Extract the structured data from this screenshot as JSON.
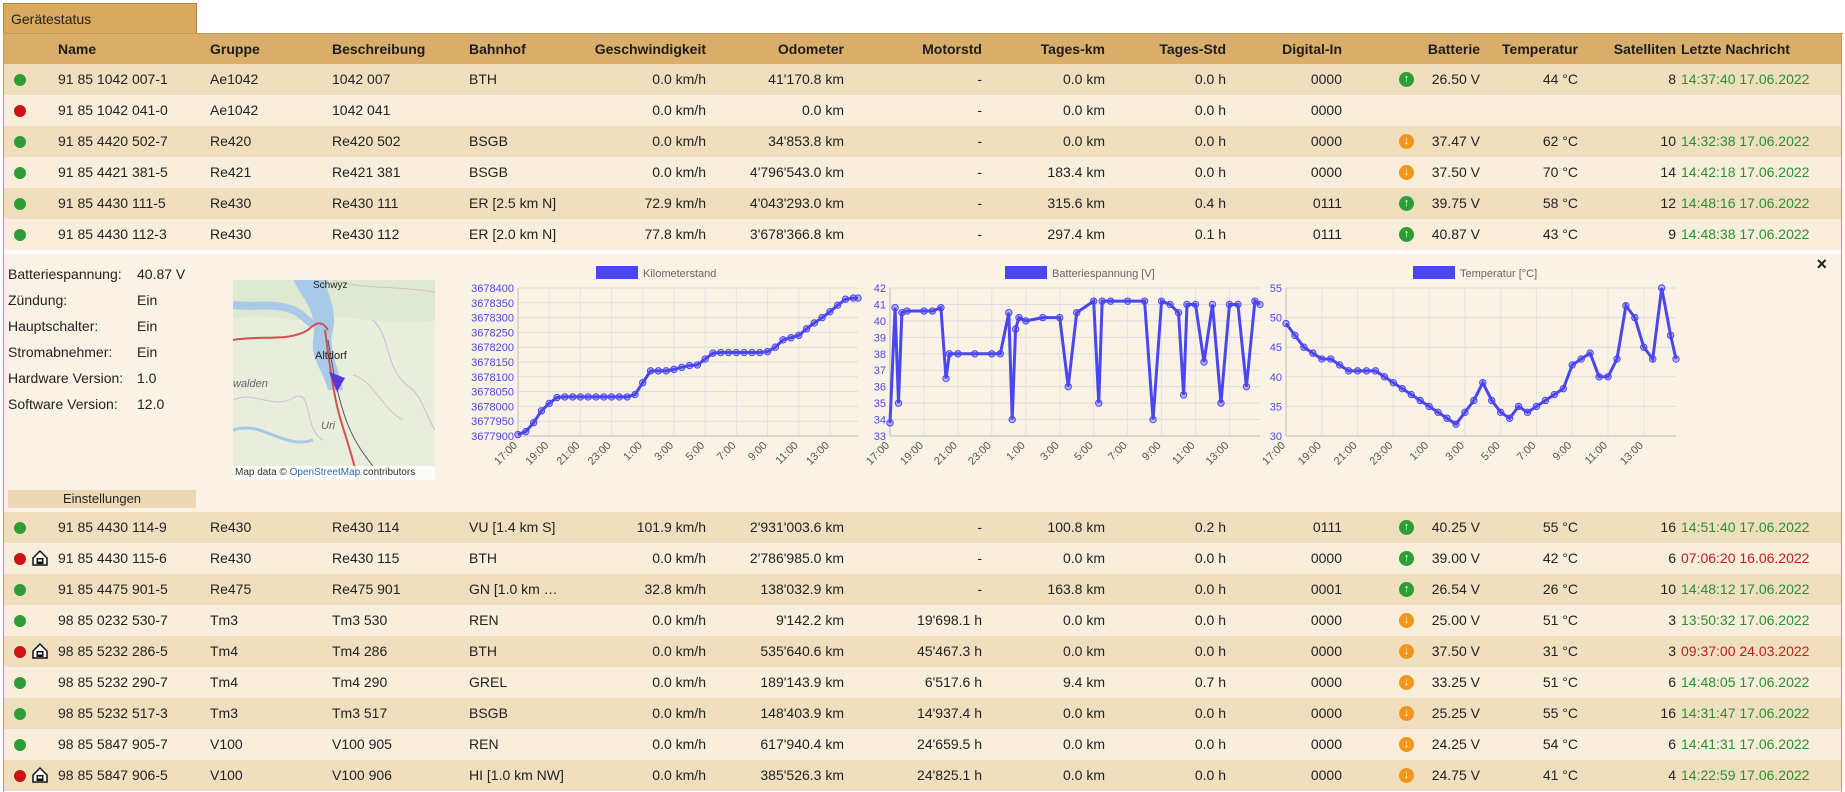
{
  "tab_title": "Gerätestatus",
  "columns": [
    "Name",
    "Gruppe",
    "Beschreibung",
    "Bahnhof",
    "Geschwindigkeit",
    "Odometer",
    "Motorstd",
    "Tages-km",
    "Tages-Std",
    "Digital-In",
    "Batterie",
    "Temperatur",
    "Satelliten",
    "Letzte Nachricht"
  ],
  "rows_top": [
    {
      "status": "green",
      "depot": false,
      "name": "91 85 1042 007-1",
      "gruppe": "Ae1042",
      "beschreibung": "1042 007",
      "bahnhof": "BTH",
      "speed": "0.0 km/h",
      "odometer": "41'170.8 km",
      "motorstd": "-",
      "tages_km": "0.0 km",
      "tages_std": "0.0 h",
      "digital_in": "0000",
      "battery_trend": "up",
      "battery": "26.50 V",
      "temp": "44 °C",
      "sat": "8",
      "last": "14:37:40 17.06.2022",
      "last_color": "green"
    },
    {
      "status": "red",
      "depot": false,
      "name": "91 85 1042 041-0",
      "gruppe": "Ae1042",
      "beschreibung": "1042 041",
      "bahnhof": "",
      "speed": "0.0 km/h",
      "odometer": "0.0 km",
      "motorstd": "-",
      "tages_km": "0.0 km",
      "tages_std": "0.0 h",
      "digital_in": "0000",
      "battery_trend": "",
      "battery": "",
      "temp": "",
      "sat": "",
      "last": "",
      "last_color": ""
    },
    {
      "status": "green",
      "depot": false,
      "name": "91 85 4420 502-7",
      "gruppe": "Re420",
      "beschreibung": "Re420 502",
      "bahnhof": "BSGB",
      "speed": "0.0 km/h",
      "odometer": "34'853.8 km",
      "motorstd": "-",
      "tages_km": "0.0 km",
      "tages_std": "0.0 h",
      "digital_in": "0000",
      "battery_trend": "down",
      "battery": "37.47 V",
      "temp": "62 °C",
      "sat": "10",
      "last": "14:32:38 17.06.2022",
      "last_color": "green"
    },
    {
      "status": "green",
      "depot": false,
      "name": "91 85 4421 381-5",
      "gruppe": "Re421",
      "beschreibung": "Re421 381",
      "bahnhof": "BSGB",
      "speed": "0.0 km/h",
      "odometer": "4'796'543.0 km",
      "motorstd": "-",
      "tages_km": "183.4 km",
      "tages_std": "0.0 h",
      "digital_in": "0000",
      "battery_trend": "down",
      "battery": "37.50 V",
      "temp": "70 °C",
      "sat": "14",
      "last": "14:42:18 17.06.2022",
      "last_color": "green"
    },
    {
      "status": "green",
      "depot": false,
      "name": "91 85 4430 111-5",
      "gruppe": "Re430",
      "beschreibung": "Re430 111",
      "bahnhof": "ER [2.5 km N]",
      "speed": "72.9 km/h",
      "odometer": "4'043'293.0 km",
      "motorstd": "-",
      "tages_km": "315.6 km",
      "tages_std": "0.4 h",
      "digital_in": "0111",
      "battery_trend": "up",
      "battery": "39.75 V",
      "temp": "58 °C",
      "sat": "12",
      "last": "14:48:16 17.06.2022",
      "last_color": "green"
    },
    {
      "status": "green",
      "depot": false,
      "name": "91 85 4430 112-3",
      "gruppe": "Re430",
      "beschreibung": "Re430 112",
      "bahnhof": "ER [2.0 km N]",
      "speed": "77.8 km/h",
      "odometer": "3'678'366.8 km",
      "motorstd": "-",
      "tages_km": "297.4 km",
      "tages_std": "0.1 h",
      "digital_in": "0111",
      "battery_trend": "up",
      "battery": "40.87 V",
      "temp": "43 °C",
      "sat": "9",
      "last": "14:48:38 17.06.2022",
      "last_color": "green"
    }
  ],
  "detail": {
    "fields": [
      {
        "label": "Batteriespannung:",
        "value": "40.87 V"
      },
      {
        "label": "Zündung:",
        "value": "Ein"
      },
      {
        "label": "Hauptschalter:",
        "value": "Ein"
      },
      {
        "label": "Stromabnehmer:",
        "value": "Ein"
      },
      {
        "label": "Hardware Version:",
        "value": "1.0"
      },
      {
        "label": "Software Version:",
        "value": "12.0"
      }
    ],
    "settings_label": "Einstellungen",
    "close_label": "×",
    "map": {
      "labels": [
        "Schwyz",
        "Altdorf",
        "Uri",
        "walden"
      ],
      "attribution_prefix": "Map data © ",
      "attribution_link": "OpenStreetMap",
      "attribution_suffix": " contributors"
    }
  },
  "chart_data": [
    {
      "type": "line",
      "legend": "Kilometerstand",
      "ylim": [
        3677900,
        3678400
      ],
      "yticks": [
        3677900,
        3677950,
        3678000,
        3678050,
        3678100,
        3678150,
        3678200,
        3678250,
        3678300,
        3678350,
        3678400
      ],
      "xticks": [
        "17:00",
        "19:00",
        "21:00",
        "23:00",
        "1:00",
        "3:00",
        "5:00",
        "7:00",
        "9:00",
        "11:00",
        "13:00"
      ],
      "x": [
        17.0,
        17.5,
        18.0,
        18.5,
        19.0,
        19.5,
        20.0,
        20.5,
        21.0,
        21.5,
        22.0,
        22.5,
        23.0,
        23.5,
        24.0,
        24.5,
        25.0,
        25.5,
        26.0,
        26.5,
        27.0,
        27.5,
        28.0,
        28.5,
        29.0,
        29.5,
        30.0,
        30.5,
        31.0,
        31.5,
        32.0,
        32.5,
        33.0,
        33.5,
        34.0,
        34.5,
        35.0,
        35.5,
        36.0,
        36.5,
        37.0,
        37.5,
        38.0,
        38.5,
        38.8
      ],
      "values": [
        3677905,
        3677915,
        3677945,
        3677985,
        3678010,
        3678030,
        3678032,
        3678032,
        3678032,
        3678032,
        3678032,
        3678032,
        3678032,
        3678032,
        3678032,
        3678040,
        3678080,
        3678120,
        3678120,
        3678120,
        3678125,
        3678132,
        3678138,
        3678140,
        3678160,
        3678180,
        3678182,
        3678182,
        3678182,
        3678182,
        3678182,
        3678182,
        3678185,
        3678200,
        3678225,
        3678232,
        3678240,
        3678262,
        3678282,
        3678300,
        3678320,
        3678342,
        3678362,
        3678366,
        3678366
      ]
    },
    {
      "type": "line",
      "legend": "Batteriespannung [V]",
      "ylim": [
        33,
        42
      ],
      "yticks": [
        33,
        34,
        35,
        36,
        37,
        38,
        39,
        40,
        41,
        42
      ],
      "xticks": [
        "17:00",
        "19:00",
        "21:00",
        "23:00",
        "1:00",
        "3:00",
        "5:00",
        "7:00",
        "9:00",
        "11:00",
        "13:00"
      ],
      "x": [
        17.0,
        17.3,
        17.5,
        17.7,
        18.0,
        19.0,
        19.5,
        20.0,
        20.3,
        20.5,
        21.0,
        22.0,
        23.0,
        23.5,
        24.0,
        24.2,
        24.4,
        24.6,
        25.0,
        26.0,
        27.0,
        27.5,
        28.0,
        29.0,
        29.3,
        29.5,
        30.0,
        31.0,
        32.0,
        32.5,
        33.0,
        33.5,
        34.0,
        34.3,
        34.5,
        35.0,
        35.5,
        36.0,
        36.5,
        37.0,
        37.5,
        38.0,
        38.5,
        38.8
      ],
      "values": [
        33.8,
        40.8,
        35.0,
        40.5,
        40.6,
        40.6,
        40.6,
        40.8,
        36.5,
        38.0,
        38.0,
        38.0,
        38.0,
        38.0,
        40.5,
        34.0,
        39.5,
        40.2,
        40.0,
        40.2,
        40.2,
        36.0,
        40.5,
        41.2,
        35.0,
        41.2,
        41.2,
        41.2,
        41.2,
        34.0,
        41.2,
        41.0,
        40.5,
        35.5,
        41.0,
        41.0,
        37.5,
        41.0,
        35.0,
        41.0,
        41.0,
        36.0,
        41.2,
        41.0
      ]
    },
    {
      "type": "line",
      "legend": "Temperatur [°C]",
      "ylim": [
        30,
        55
      ],
      "yticks": [
        30,
        35,
        40,
        45,
        50,
        55
      ],
      "xticks": [
        "17:00",
        "19:00",
        "21:00",
        "23:00",
        "1:00",
        "3:00",
        "5:00",
        "7:00",
        "9:00",
        "11:00",
        "13:00"
      ],
      "x": [
        17.0,
        17.5,
        18.0,
        18.5,
        19.0,
        19.5,
        20.0,
        20.5,
        21.0,
        21.5,
        22.0,
        22.5,
        23.0,
        23.5,
        24.0,
        24.5,
        25.0,
        25.5,
        26.0,
        26.5,
        27.0,
        27.5,
        28.0,
        28.5,
        29.0,
        29.5,
        30.0,
        30.5,
        31.0,
        31.5,
        32.0,
        32.5,
        33.0,
        33.5,
        34.0,
        34.5,
        35.0,
        35.5,
        36.0,
        36.5,
        37.0,
        37.5,
        38.0,
        38.5,
        38.8
      ],
      "values": [
        49,
        47,
        45,
        44,
        43,
        43,
        42,
        41,
        41,
        41,
        41,
        40,
        39,
        38,
        37,
        36,
        35,
        34,
        33,
        32,
        34,
        36,
        39,
        36,
        34,
        33,
        35,
        34,
        35,
        36,
        37,
        38,
        42,
        43,
        44,
        40,
        40,
        43,
        52,
        50,
        45,
        43,
        55,
        47,
        43
      ]
    }
  ],
  "rows_bottom": [
    {
      "status": "green",
      "depot": false,
      "name": "91 85 4430 114-9",
      "gruppe": "Re430",
      "beschreibung": "Re430 114",
      "bahnhof": "VU [1.4 km S]",
      "speed": "101.9 km/h",
      "odometer": "2'931'003.6 km",
      "motorstd": "-",
      "tages_km": "100.8 km",
      "tages_std": "0.2 h",
      "digital_in": "0111",
      "battery_trend": "up",
      "battery": "40.25 V",
      "temp": "55 °C",
      "sat": "16",
      "last": "14:51:40 17.06.2022",
      "last_color": "green"
    },
    {
      "status": "red",
      "depot": true,
      "name": "91 85 4430 115-6",
      "gruppe": "Re430",
      "beschreibung": "Re430 115",
      "bahnhof": "BTH",
      "speed": "0.0 km/h",
      "odometer": "2'786'985.0 km",
      "motorstd": "-",
      "tages_km": "0.0 km",
      "tages_std": "0.0 h",
      "digital_in": "0000",
      "battery_trend": "up",
      "battery": "39.00 V",
      "temp": "42 °C",
      "sat": "6",
      "last": "07:06:20 16.06.2022",
      "last_color": "red"
    },
    {
      "status": "green",
      "depot": false,
      "name": "91 85 4475 901-5",
      "gruppe": "Re475",
      "beschreibung": "Re475 901",
      "bahnhof": "GN [1.0 km …",
      "speed": "32.8 km/h",
      "odometer": "138'032.9 km",
      "motorstd": "-",
      "tages_km": "163.8 km",
      "tages_std": "0.0 h",
      "digital_in": "0001",
      "battery_trend": "up",
      "battery": "26.54 V",
      "temp": "26 °C",
      "sat": "10",
      "last": "14:48:12 17.06.2022",
      "last_color": "green"
    },
    {
      "status": "green",
      "depot": false,
      "name": "98 85 0232 530-7",
      "gruppe": "Tm3",
      "beschreibung": "Tm3 530",
      "bahnhof": "REN",
      "speed": "0.0 km/h",
      "odometer": "9'142.2 km",
      "motorstd": "19'698.1 h",
      "tages_km": "0.0 km",
      "tages_std": "0.0 h",
      "digital_in": "0000",
      "battery_trend": "down",
      "battery": "25.00 V",
      "temp": "51 °C",
      "sat": "3",
      "last": "13:50:32 17.06.2022",
      "last_color": "green"
    },
    {
      "status": "red",
      "depot": true,
      "name": "98 85 5232 286-5",
      "gruppe": "Tm4",
      "beschreibung": "Tm4 286",
      "bahnhof": "BTH",
      "speed": "0.0 km/h",
      "odometer": "535'640.6 km",
      "motorstd": "45'467.3 h",
      "tages_km": "0.0 km",
      "tages_std": "0.0 h",
      "digital_in": "0000",
      "battery_trend": "down",
      "battery": "37.50 V",
      "temp": "31 °C",
      "sat": "3",
      "last": "09:37:00 24.03.2022",
      "last_color": "red"
    },
    {
      "status": "green",
      "depot": false,
      "name": "98 85 5232 290-7",
      "gruppe": "Tm4",
      "beschreibung": "Tm4 290",
      "bahnhof": "GREL",
      "speed": "0.0 km/h",
      "odometer": "189'143.9 km",
      "motorstd": "6'517.6 h",
      "tages_km": "9.4 km",
      "tages_std": "0.7 h",
      "digital_in": "0000",
      "battery_trend": "down",
      "battery": "33.25 V",
      "temp": "51 °C",
      "sat": "6",
      "last": "14:48:05 17.06.2022",
      "last_color": "green"
    },
    {
      "status": "green",
      "depot": false,
      "name": "98 85 5232 517-3",
      "gruppe": "Tm3",
      "beschreibung": "Tm3 517",
      "bahnhof": "BSGB",
      "speed": "0.0 km/h",
      "odometer": "148'403.9 km",
      "motorstd": "14'937.4 h",
      "tages_km": "0.0 km",
      "tages_std": "0.0 h",
      "digital_in": "0000",
      "battery_trend": "down",
      "battery": "25.25 V",
      "temp": "55 °C",
      "sat": "16",
      "last": "14:31:47 17.06.2022",
      "last_color": "green"
    },
    {
      "status": "green",
      "depot": false,
      "name": "98 85 5847 905-7",
      "gruppe": "V100",
      "beschreibung": "V100 905",
      "bahnhof": "REN",
      "speed": "0.0 km/h",
      "odometer": "617'940.4 km",
      "motorstd": "24'659.5 h",
      "tages_km": "0.0 km",
      "tages_std": "0.0 h",
      "digital_in": "0000",
      "battery_trend": "down",
      "battery": "24.25 V",
      "temp": "54 °C",
      "sat": "6",
      "last": "14:41:31 17.06.2022",
      "last_color": "green"
    },
    {
      "status": "red",
      "depot": true,
      "name": "98 85 5847 906-5",
      "gruppe": "V100",
      "beschreibung": "V100 906",
      "bahnhof": "HI [1.0 km NW]",
      "speed": "0.0 km/h",
      "odometer": "385'526.3 km",
      "motorstd": "24'825.1 h",
      "tages_km": "0.0 km",
      "tages_std": "0.0 h",
      "digital_in": "0000",
      "battery_trend": "down",
      "battery": "24.75 V",
      "temp": "41 °C",
      "sat": "4",
      "last": "14:22:59 17.06.2022",
      "last_color": "green"
    }
  ],
  "colors": {
    "header": "#d9ad6a",
    "row_a": "#f0dfbf",
    "row_b": "#f8eedb",
    "status_ok": "#2e9d35",
    "status_error": "#cc1414",
    "trend_up": "#2e9d35",
    "trend_down": "#f0961e",
    "chart_line": "#4a46f0"
  }
}
